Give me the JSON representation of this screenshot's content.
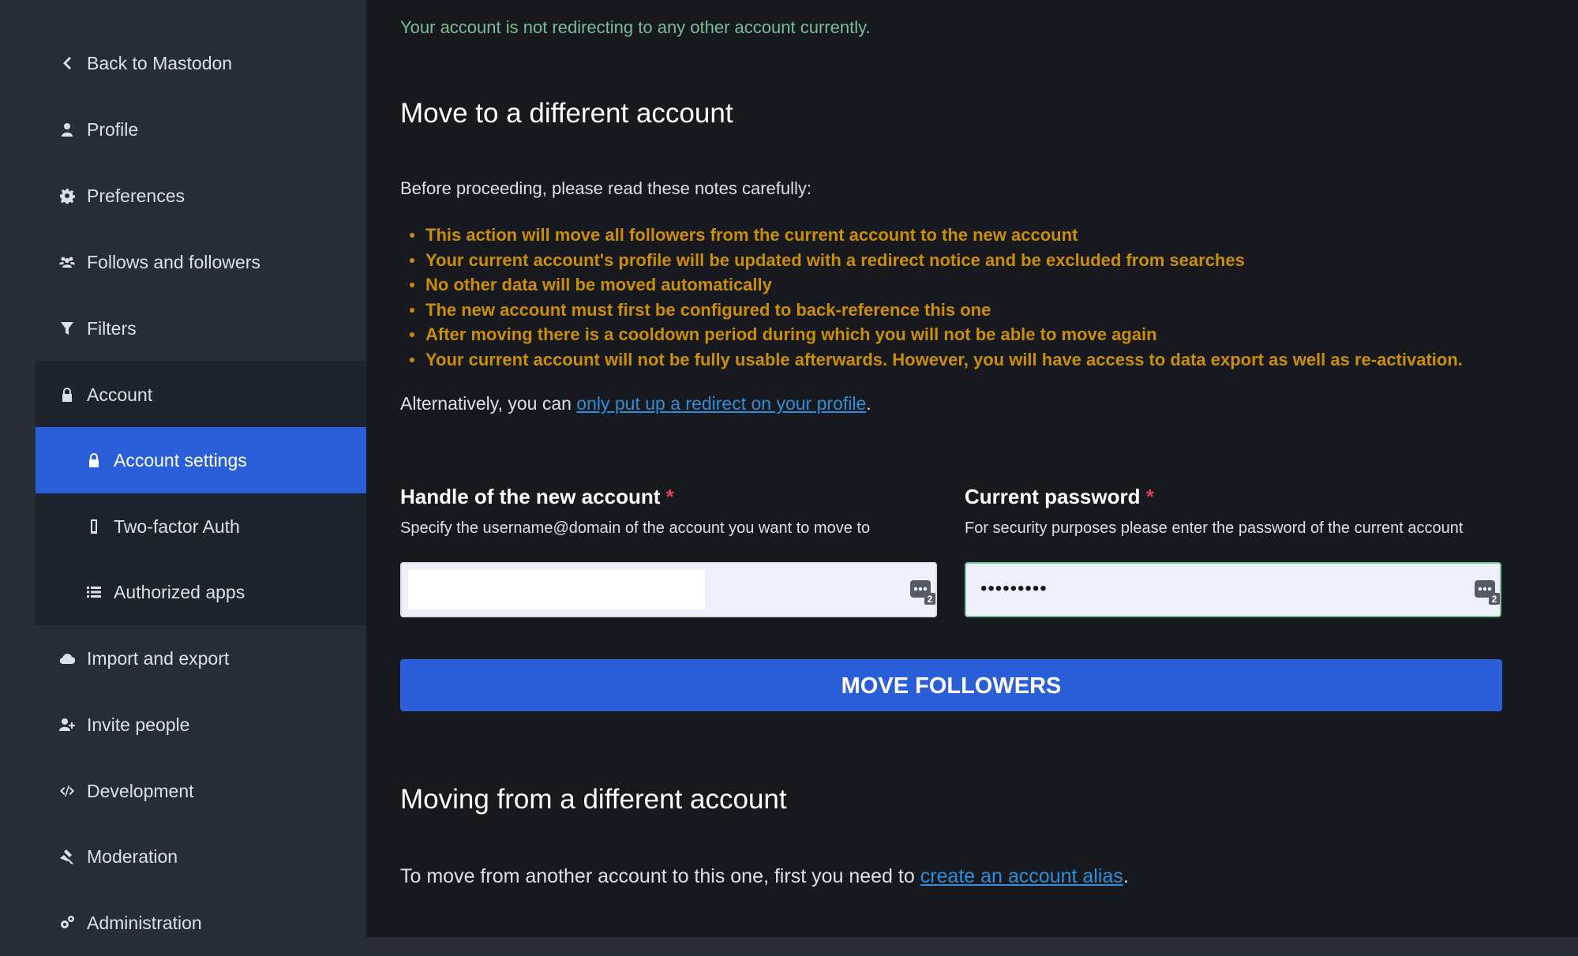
{
  "sidebar": {
    "back": "Back to Mastodon",
    "items": [
      {
        "label": "Profile",
        "icon": "user-icon"
      },
      {
        "label": "Preferences",
        "icon": "gear-icon"
      },
      {
        "label": "Follows and followers",
        "icon": "users-icon"
      },
      {
        "label": "Filters",
        "icon": "filter-icon"
      },
      {
        "label": "Account",
        "icon": "lock-icon"
      },
      {
        "label": "Account settings",
        "icon": "lock-icon",
        "active": true
      },
      {
        "label": "Two-factor Auth",
        "icon": "mobile-icon"
      },
      {
        "label": "Authorized apps",
        "icon": "list-icon"
      },
      {
        "label": "Import and export",
        "icon": "cloud-icon"
      },
      {
        "label": "Invite people",
        "icon": "user-plus-icon"
      },
      {
        "label": "Development",
        "icon": "code-icon"
      },
      {
        "label": "Moderation",
        "icon": "gavel-icon"
      },
      {
        "label": "Administration",
        "icon": "cogs-icon"
      }
    ]
  },
  "main": {
    "notice": "Your account is not redirecting to any other account currently.",
    "move_section": {
      "title": "Move to a different account",
      "lead": "Before proceeding, please read these notes carefully:",
      "warnings": [
        "This action will move all followers from the current account to the new account",
        "Your current account's profile will be updated with a redirect notice and be excluded from searches",
        "No other data will be moved automatically",
        "The new account must first be configured to back-reference this one",
        "After moving there is a cooldown period during which you will not be able to move again",
        "Your current account will not be fully usable afterwards. However, you will have access to data export as well as re-activation."
      ],
      "alt_prefix": "Alternatively, you can ",
      "alt_link": "only put up a redirect on your profile",
      "alt_suffix": "."
    },
    "form": {
      "handle_label": "Handle of the new account",
      "handle_hint": "Specify the username@domain of the account you want to move to",
      "handle_value": "",
      "password_label": "Current password",
      "password_hint": "For security purposes please enter the password of the current account",
      "password_value": "•••••••••",
      "required_mark": "*",
      "pm_badge": "2",
      "submit": "MOVE FOLLOWERS"
    },
    "from_section": {
      "title": "Moving from a different account",
      "text_prefix": "To move from another account to this one, first you need to ",
      "link": "create an account alias",
      "text_suffix": "."
    }
  },
  "colors": {
    "accent": "#2b5fd9",
    "warning": "#ca8f04",
    "success": "#79bd9a",
    "link": "#2b90d9",
    "required": "#df405a"
  }
}
